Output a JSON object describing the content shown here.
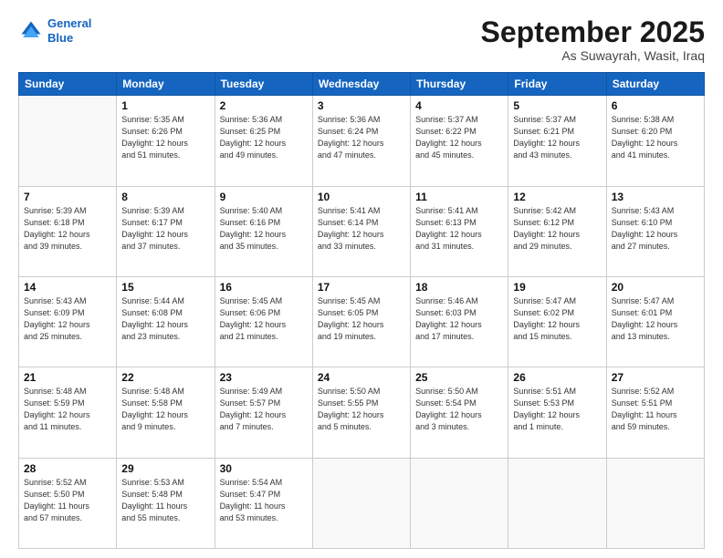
{
  "header": {
    "logo_line1": "General",
    "logo_line2": "Blue",
    "month": "September 2025",
    "location": "As Suwayrah, Wasit, Iraq"
  },
  "weekdays": [
    "Sunday",
    "Monday",
    "Tuesday",
    "Wednesday",
    "Thursday",
    "Friday",
    "Saturday"
  ],
  "weeks": [
    [
      {
        "day": "",
        "info": ""
      },
      {
        "day": "1",
        "info": "Sunrise: 5:35 AM\nSunset: 6:26 PM\nDaylight: 12 hours\nand 51 minutes."
      },
      {
        "day": "2",
        "info": "Sunrise: 5:36 AM\nSunset: 6:25 PM\nDaylight: 12 hours\nand 49 minutes."
      },
      {
        "day": "3",
        "info": "Sunrise: 5:36 AM\nSunset: 6:24 PM\nDaylight: 12 hours\nand 47 minutes."
      },
      {
        "day": "4",
        "info": "Sunrise: 5:37 AM\nSunset: 6:22 PM\nDaylight: 12 hours\nand 45 minutes."
      },
      {
        "day": "5",
        "info": "Sunrise: 5:37 AM\nSunset: 6:21 PM\nDaylight: 12 hours\nand 43 minutes."
      },
      {
        "day": "6",
        "info": "Sunrise: 5:38 AM\nSunset: 6:20 PM\nDaylight: 12 hours\nand 41 minutes."
      }
    ],
    [
      {
        "day": "7",
        "info": "Sunrise: 5:39 AM\nSunset: 6:18 PM\nDaylight: 12 hours\nand 39 minutes."
      },
      {
        "day": "8",
        "info": "Sunrise: 5:39 AM\nSunset: 6:17 PM\nDaylight: 12 hours\nand 37 minutes."
      },
      {
        "day": "9",
        "info": "Sunrise: 5:40 AM\nSunset: 6:16 PM\nDaylight: 12 hours\nand 35 minutes."
      },
      {
        "day": "10",
        "info": "Sunrise: 5:41 AM\nSunset: 6:14 PM\nDaylight: 12 hours\nand 33 minutes."
      },
      {
        "day": "11",
        "info": "Sunrise: 5:41 AM\nSunset: 6:13 PM\nDaylight: 12 hours\nand 31 minutes."
      },
      {
        "day": "12",
        "info": "Sunrise: 5:42 AM\nSunset: 6:12 PM\nDaylight: 12 hours\nand 29 minutes."
      },
      {
        "day": "13",
        "info": "Sunrise: 5:43 AM\nSunset: 6:10 PM\nDaylight: 12 hours\nand 27 minutes."
      }
    ],
    [
      {
        "day": "14",
        "info": "Sunrise: 5:43 AM\nSunset: 6:09 PM\nDaylight: 12 hours\nand 25 minutes."
      },
      {
        "day": "15",
        "info": "Sunrise: 5:44 AM\nSunset: 6:08 PM\nDaylight: 12 hours\nand 23 minutes."
      },
      {
        "day": "16",
        "info": "Sunrise: 5:45 AM\nSunset: 6:06 PM\nDaylight: 12 hours\nand 21 minutes."
      },
      {
        "day": "17",
        "info": "Sunrise: 5:45 AM\nSunset: 6:05 PM\nDaylight: 12 hours\nand 19 minutes."
      },
      {
        "day": "18",
        "info": "Sunrise: 5:46 AM\nSunset: 6:03 PM\nDaylight: 12 hours\nand 17 minutes."
      },
      {
        "day": "19",
        "info": "Sunrise: 5:47 AM\nSunset: 6:02 PM\nDaylight: 12 hours\nand 15 minutes."
      },
      {
        "day": "20",
        "info": "Sunrise: 5:47 AM\nSunset: 6:01 PM\nDaylight: 12 hours\nand 13 minutes."
      }
    ],
    [
      {
        "day": "21",
        "info": "Sunrise: 5:48 AM\nSunset: 5:59 PM\nDaylight: 12 hours\nand 11 minutes."
      },
      {
        "day": "22",
        "info": "Sunrise: 5:48 AM\nSunset: 5:58 PM\nDaylight: 12 hours\nand 9 minutes."
      },
      {
        "day": "23",
        "info": "Sunrise: 5:49 AM\nSunset: 5:57 PM\nDaylight: 12 hours\nand 7 minutes."
      },
      {
        "day": "24",
        "info": "Sunrise: 5:50 AM\nSunset: 5:55 PM\nDaylight: 12 hours\nand 5 minutes."
      },
      {
        "day": "25",
        "info": "Sunrise: 5:50 AM\nSunset: 5:54 PM\nDaylight: 12 hours\nand 3 minutes."
      },
      {
        "day": "26",
        "info": "Sunrise: 5:51 AM\nSunset: 5:53 PM\nDaylight: 12 hours\nand 1 minute."
      },
      {
        "day": "27",
        "info": "Sunrise: 5:52 AM\nSunset: 5:51 PM\nDaylight: 11 hours\nand 59 minutes."
      }
    ],
    [
      {
        "day": "28",
        "info": "Sunrise: 5:52 AM\nSunset: 5:50 PM\nDaylight: 11 hours\nand 57 minutes."
      },
      {
        "day": "29",
        "info": "Sunrise: 5:53 AM\nSunset: 5:48 PM\nDaylight: 11 hours\nand 55 minutes."
      },
      {
        "day": "30",
        "info": "Sunrise: 5:54 AM\nSunset: 5:47 PM\nDaylight: 11 hours\nand 53 minutes."
      },
      {
        "day": "",
        "info": ""
      },
      {
        "day": "",
        "info": ""
      },
      {
        "day": "",
        "info": ""
      },
      {
        "day": "",
        "info": ""
      }
    ]
  ]
}
